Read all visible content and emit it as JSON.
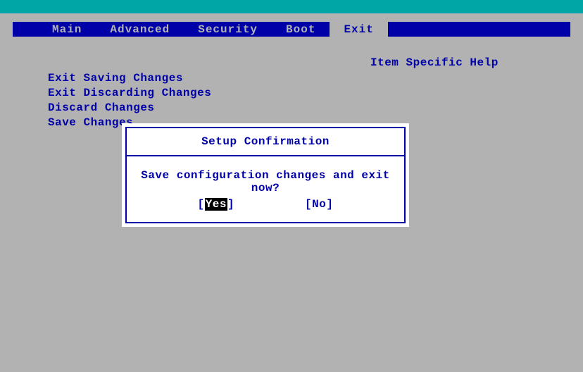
{
  "menubar": {
    "items": [
      {
        "label": "Main"
      },
      {
        "label": "Advanced"
      },
      {
        "label": "Security"
      },
      {
        "label": "Boot"
      },
      {
        "label": "Exit",
        "selected": true
      }
    ]
  },
  "help": {
    "title": "Item Specific Help"
  },
  "exit_menu": {
    "items": [
      {
        "label": "Exit Saving Changes"
      },
      {
        "label": "Exit Discarding Changes"
      },
      {
        "label": "Discard Changes"
      },
      {
        "label": "Save Changes"
      }
    ]
  },
  "dialog": {
    "title": "Setup Confirmation",
    "message": "Save configuration changes and exit now?",
    "yes": "Yes",
    "no": "No",
    "selected": "yes",
    "bracket_open": "[",
    "bracket_close": "]"
  }
}
